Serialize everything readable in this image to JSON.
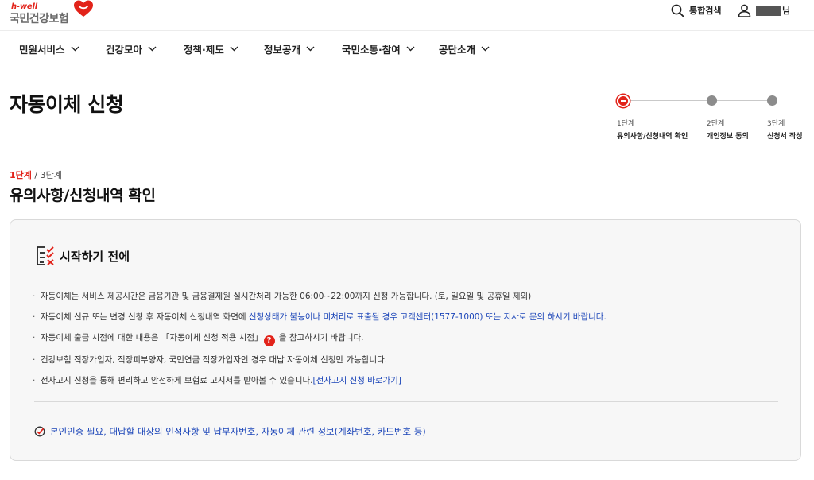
{
  "header": {
    "logo_tag": "h-well",
    "logo_text": "국민건강보험",
    "search_label": "통합검색",
    "user_suffix": "님"
  },
  "nav": [
    {
      "label": "민원서비스"
    },
    {
      "label": "건강모아"
    },
    {
      "label": "정책·제도"
    },
    {
      "label": "정보공개"
    },
    {
      "label": "국민소통·참여"
    },
    {
      "label": "공단소개"
    }
  ],
  "page": {
    "title": "자동이체 신청"
  },
  "stepper": [
    {
      "num": "1단계",
      "label": "유의사항/신청내역 확인",
      "active": true
    },
    {
      "num": "2단계",
      "label": "개인정보 동의",
      "active": false
    },
    {
      "num": "3단계",
      "label": "신청서 작성",
      "active": false
    }
  ],
  "step_indicator": {
    "current": "1단계",
    "total": " / 3단계"
  },
  "section": {
    "title": "유의사항/신청내역 확인"
  },
  "notice": {
    "title": "시작하기 전에",
    "items": [
      {
        "text": "자동이체는 서비스 제공시간은 금융기관 및 금융결제원 실시간처리 가능한 06:00~22:00까지 신청 가능합니다. (토, 일요일 및 공휴일 제외)"
      },
      {
        "pre": "자동이체 신규 또는 변경 신청 후 자동이체 신청내역 화면에 ",
        "highlight": "신청상태가 불능이나 미처리로 표출될 경우 고객센터(1577-1000) 또는 지사로 문의 하시기 바랍니다."
      },
      {
        "pre": "자동이체 출금 시점에 대한 내용은 「자동이체 신청 적용 시점」",
        "icon": "?",
        "post": " 을 참고하시기 바랍니다."
      },
      {
        "text": "건강보험 직장가입자, 직장피부양자, 국민연금 직장가입자인 경우 대납 자동이체 신청만 가능합니다."
      },
      {
        "pre": "전자고지 신청을 통해 편리하고 안전하게 보험료 고지서를 받아볼 수 있습니다.",
        "link": "[전자고지 신청 바로가기]"
      }
    ],
    "requirement": "본인인증 필요, 대납할 대상의 인적사항 및 납부자번호, 자동이체 관련 정보(계좌번호, 카드번호 등)"
  },
  "colors": {
    "accent": "#e2231a",
    "link": "#1a44b8"
  }
}
